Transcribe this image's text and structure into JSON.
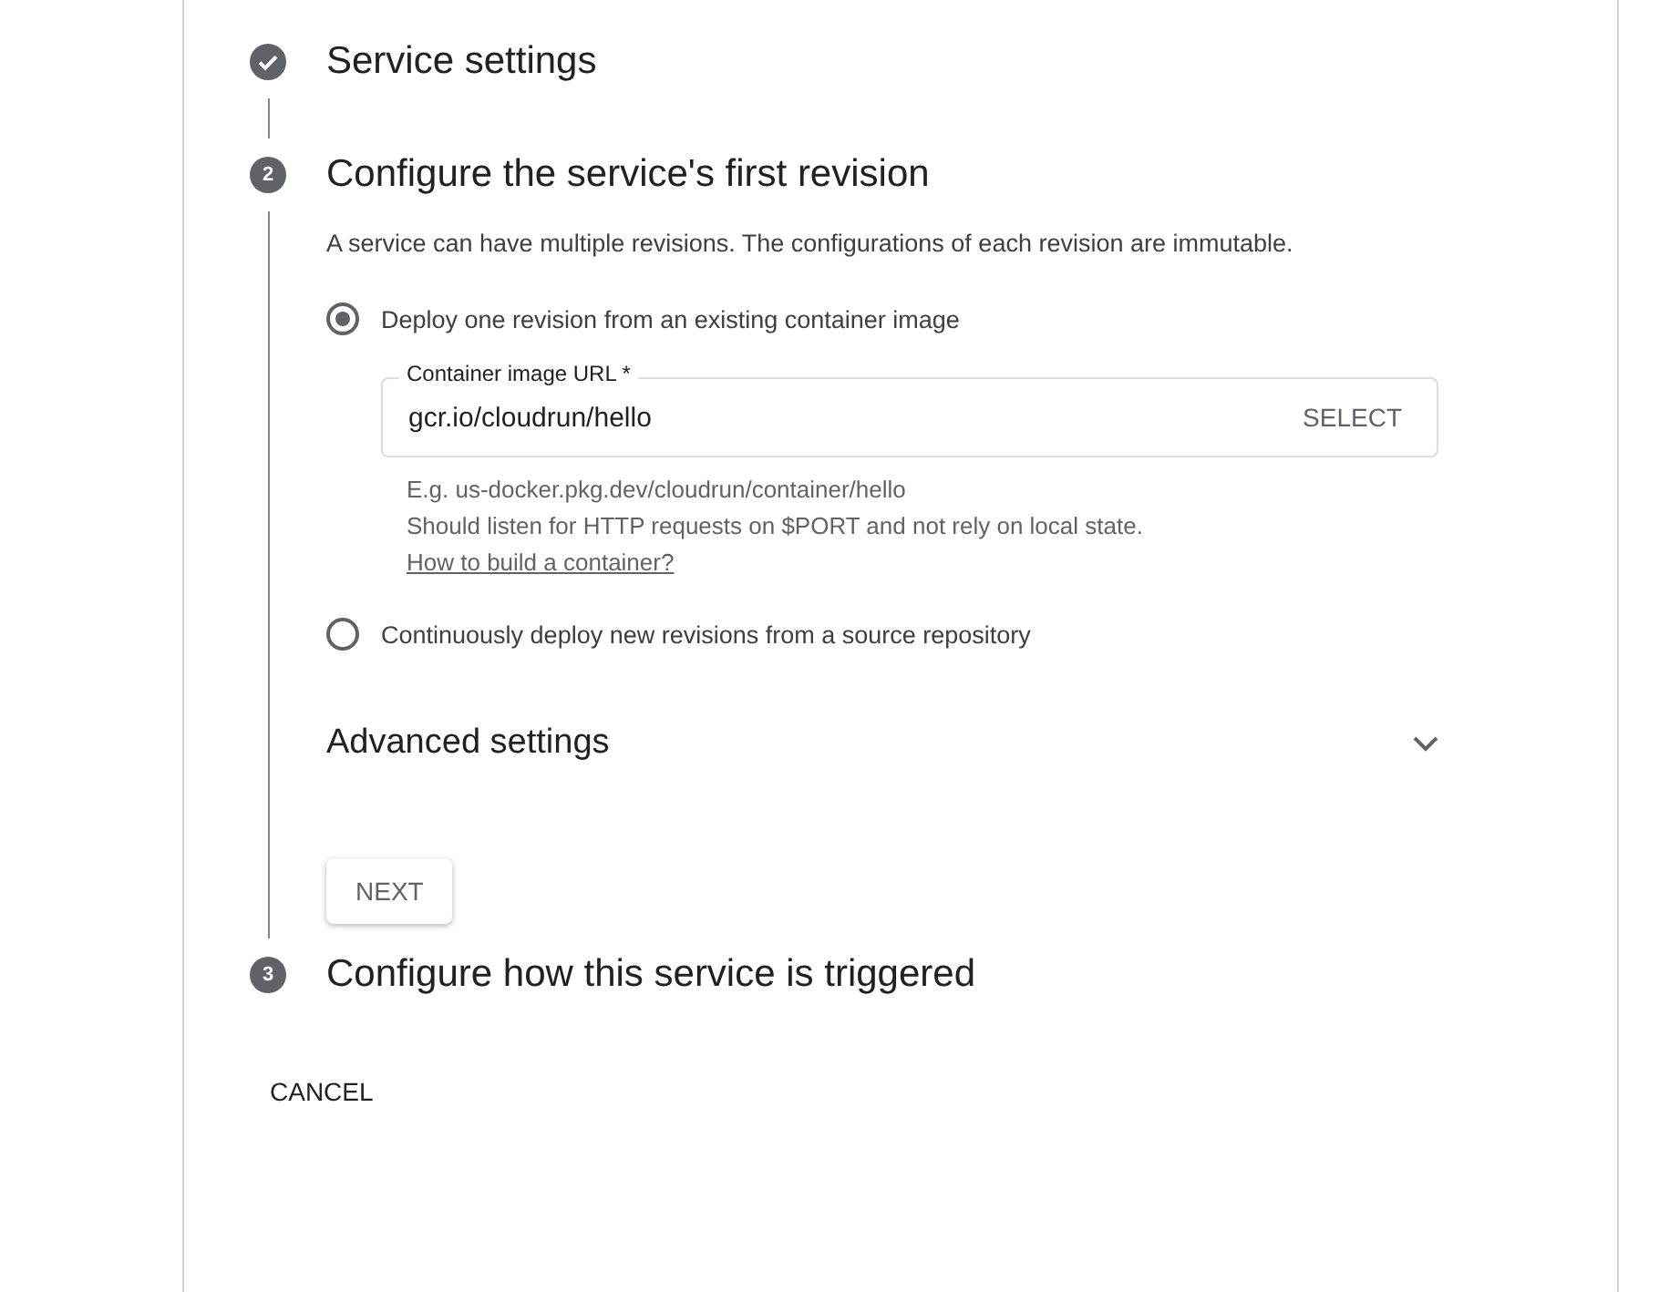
{
  "steps": [
    {
      "kind": "done",
      "title": "Service settings"
    },
    {
      "kind": "active",
      "number": "2",
      "title": "Configure the service's first revision"
    },
    {
      "kind": "pending",
      "number": "3",
      "title": "Configure how this service is triggered"
    }
  ],
  "description": "A service can have multiple revisions. The configurations of each revision are immutable.",
  "options": [
    {
      "label": "Deploy one revision from an existing container image",
      "selected": true
    },
    {
      "label": "Continuously deploy new revisions from a source repository",
      "selected": false
    }
  ],
  "image_field": {
    "label": "Container image URL *",
    "value": "gcr.io/cloudrun/hello",
    "action": "SELECT"
  },
  "hint": "E.g. us-docker.pkg.dev/cloudrun/container/hello",
  "note": "Should listen for HTTP requests on $PORT and not rely on local state.",
  "note_link": "How to build a container?",
  "advanced": {
    "title": "Advanced settings",
    "expanded": false
  },
  "next_button": "NEXT",
  "cancel_button": "CANCEL"
}
